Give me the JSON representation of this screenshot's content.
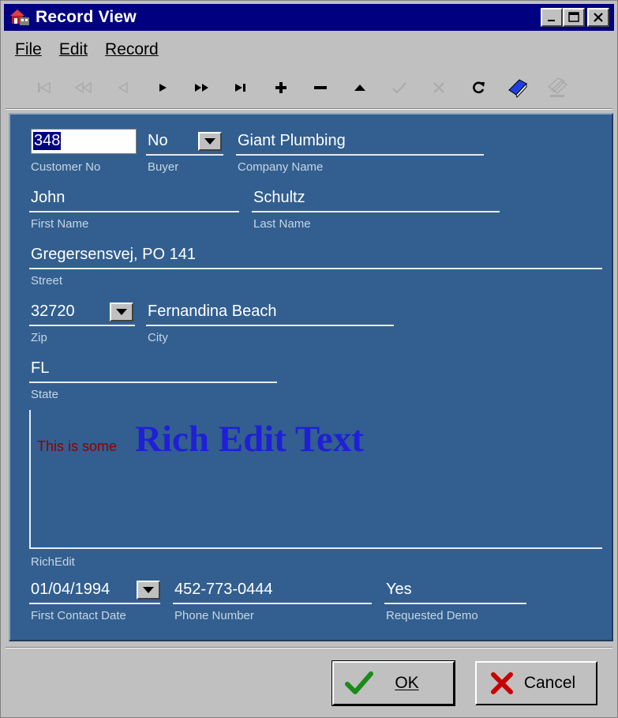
{
  "window": {
    "title": "Record View"
  },
  "menu": [
    {
      "label": "File"
    },
    {
      "label": "Edit"
    },
    {
      "label": "Record"
    }
  ],
  "toolbar": {
    "buttons": [
      {
        "name": "first-record-icon",
        "enabled": false
      },
      {
        "name": "prior-page-icon",
        "enabled": false
      },
      {
        "name": "prior-record-icon",
        "enabled": false
      },
      {
        "name": "next-record-icon",
        "enabled": true
      },
      {
        "name": "next-page-icon",
        "enabled": true
      },
      {
        "name": "last-record-icon",
        "enabled": true
      },
      {
        "name": "insert-icon",
        "enabled": true
      },
      {
        "name": "delete-icon",
        "enabled": true
      },
      {
        "name": "edit-icon",
        "enabled": true
      },
      {
        "name": "post-icon",
        "enabled": false
      },
      {
        "name": "cancel-edit-icon",
        "enabled": false
      },
      {
        "name": "refresh-icon",
        "enabled": true
      },
      {
        "name": "bookmark-icon",
        "enabled": true
      },
      {
        "name": "goto-bookmark-icon",
        "enabled": false
      }
    ]
  },
  "form": {
    "customer_no": {
      "label": "Customer No",
      "value": "348"
    },
    "buyer": {
      "label": "Buyer",
      "value": "No"
    },
    "company_name": {
      "label": "Company Name",
      "value": "Giant Plumbing"
    },
    "first_name": {
      "label": "First Name",
      "value": "John"
    },
    "last_name": {
      "label": "Last Name",
      "value": "Schultz"
    },
    "street": {
      "label": "Street",
      "value": "Gregersensvej, PO 141"
    },
    "zip": {
      "label": "Zip",
      "value": "32720"
    },
    "city": {
      "label": "City",
      "value": "Fernandina Beach"
    },
    "state": {
      "label": "State",
      "value": "FL"
    },
    "rich_edit": {
      "label": "RichEdit",
      "small_text": "This is some",
      "big_text": "Rich Edit Text",
      "small_color": "#8b0000",
      "big_color": "#1f1fd8"
    },
    "first_contact_date": {
      "label": "First Contact Date",
      "value": "01/04/1994"
    },
    "phone_number": {
      "label": "Phone Number",
      "value": "452-773-0444"
    },
    "requested_demo": {
      "label": "Requested Demo",
      "value": "Yes"
    }
  },
  "buttons": {
    "ok": "OK",
    "cancel": "Cancel"
  },
  "colors": {
    "title_bar": "#000080",
    "panel": "#325f8f",
    "face": "#c0c0c0"
  }
}
